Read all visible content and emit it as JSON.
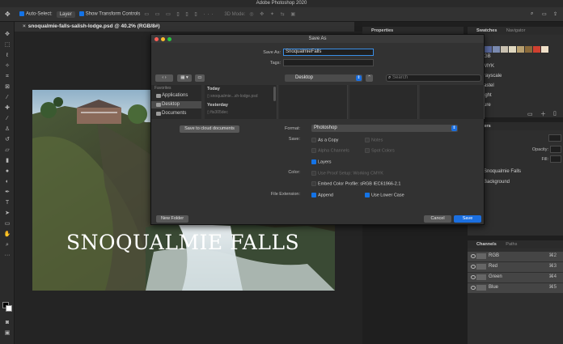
{
  "app": {
    "title": "Adobe Photoshop 2020"
  },
  "options_bar": {
    "auto_select_label": "Auto-Select:",
    "auto_select_value": "Layer",
    "show_transform_label": "Show Transform Controls",
    "mode_3d": "3D Mode:"
  },
  "document": {
    "tab_title": "snoqualmie-falls-salish-lodge.psd @ 40.2% (RGB/8#)",
    "image_text": "SNOQUALMIE FALLS"
  },
  "panels": {
    "properties_tab": "Properties",
    "swatches_tab": "Swatches",
    "navigator_tab": "Navigator",
    "swatch_colors": [
      "#2a3a6a",
      "#3a4e8c",
      "#5a6aa0",
      "#7a8ab0",
      "#c8c0b0",
      "#e0d8c0",
      "#b8a070",
      "#8a6a3a",
      "#d04030",
      "#f0e0c8"
    ],
    "swatch_list_fragments": [
      "GB",
      "MYK",
      "rayscale",
      "astel",
      "ight",
      "ure"
    ],
    "layers_tab": "Layers",
    "opacity_label": "Opacity:",
    "fill_label": "Fill:",
    "layers": [
      "Snoqualmie Falls",
      "Background"
    ],
    "channels_tab": "Channels",
    "paths_tab": "Paths",
    "channels": [
      {
        "name": "RGB",
        "shortcut": "⌘2"
      },
      {
        "name": "Red",
        "shortcut": "⌘3"
      },
      {
        "name": "Green",
        "shortcut": "⌘4"
      },
      {
        "name": "Blue",
        "shortcut": "⌘5"
      }
    ]
  },
  "dialog": {
    "title": "Save As",
    "save_as_label": "Save As:",
    "save_as_value": "SnoqualmieFalls",
    "tags_label": "Tags:",
    "location": "Desktop",
    "search_placeholder": "Search",
    "favorites_label": "Favorites",
    "sidebar": [
      "Applications",
      "Desktop",
      "Documents"
    ],
    "today_label": "Today",
    "today_file": "snoqualmie...sh-lodge.psd",
    "yesterday_label": "Yesterday",
    "yesterday_file": "fts305dec",
    "cloud_button": "Save to cloud documents",
    "format_label": "Format:",
    "format_value": "Photoshop",
    "save_label": "Save:",
    "as_copy": "As a Copy",
    "notes": "Notes",
    "alpha_channels": "Alpha Channels",
    "spot_colors": "Spot Colors",
    "layers": "Layers",
    "color_label": "Color:",
    "use_proof_setup": "Use Proof Setup:  Working CMYK",
    "embed_profile": "Embed Color Profile:  sRGB IEC61966-2.1",
    "file_extension_label": "File Extension:",
    "append": "Append",
    "use_lower_case": "Use Lower Case",
    "new_folder_button": "New Folder",
    "cancel_button": "Cancel",
    "save_button": "Save"
  }
}
